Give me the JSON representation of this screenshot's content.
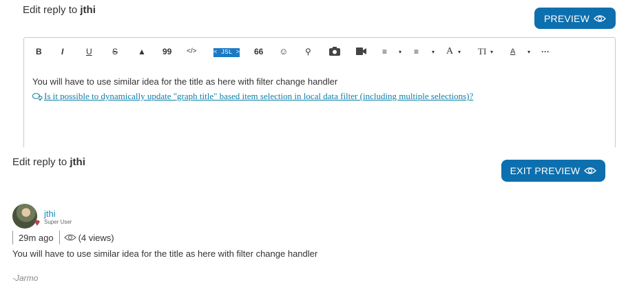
{
  "editor_section": {
    "title_prefix": "Edit reply to",
    "title_user": "jthi",
    "preview_label": "PREVIEW"
  },
  "toolbar": {
    "bold": "B",
    "italic": "I",
    "underline": "U",
    "strike": "S",
    "spoiler": "▲",
    "quote": "99",
    "code": "</>",
    "jsl": "< JSL >",
    "blockquote": "66",
    "emoji": "☺",
    "link": "⚲",
    "photo": "📷",
    "video": "▶",
    "numbered_list": "≡",
    "bulleted_list": "≡",
    "font_color": "A",
    "text_size": "TI",
    "text_format": "A",
    "more": "···",
    "caret": "▾"
  },
  "editor": {
    "line1": "You will have to use similar idea for the title as here with filter change handler",
    "link_text": "Is it possible to dynamically update \"graph title\" based item selection in local data filter (including multiple selections)?"
  },
  "preview_section": {
    "title_prefix": "Edit reply to",
    "title_user": "jthi",
    "exit_preview_label": "EXIT PREVIEW"
  },
  "post": {
    "username": "jthi",
    "rank": "Super User",
    "time_ago": "29m ago",
    "views": "(4 views)",
    "body": "You will have to use similar idea for the title as here with filter change handler",
    "signature": "-Jarmo"
  },
  "colors": {
    "primary_button": "#0d6fae",
    "link": "#1a87b9",
    "jsl_badge": "#1a7ac4"
  }
}
